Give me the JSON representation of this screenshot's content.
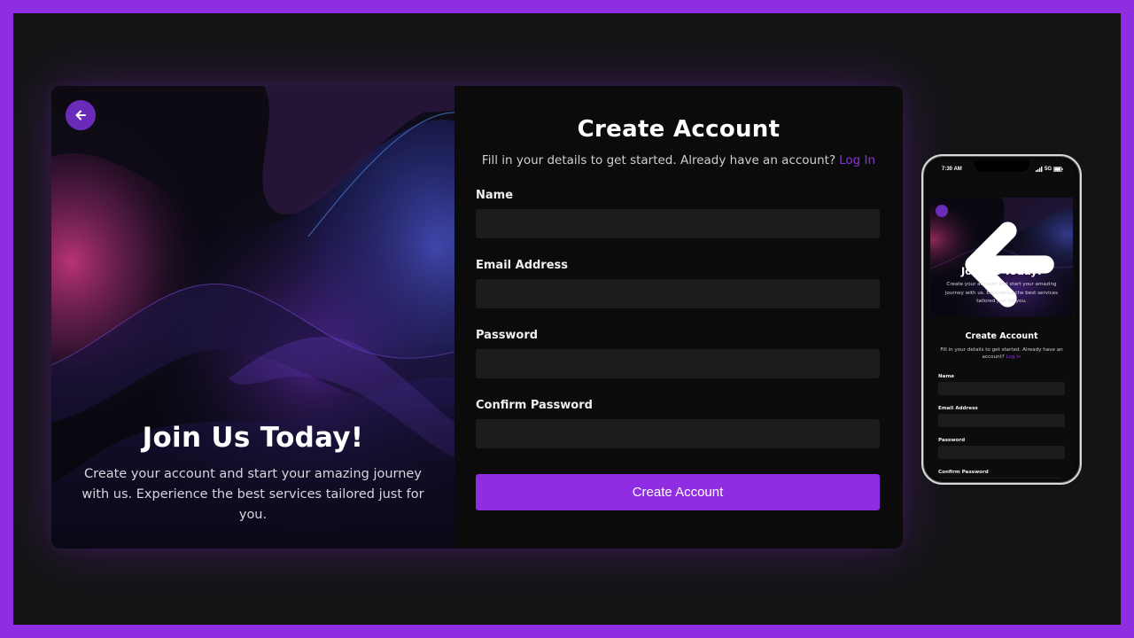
{
  "desktop": {
    "hero": {
      "back_icon": "arrow-left-icon",
      "title": "Join Us Today!",
      "description": "Create your account and start your amazing journey with us. Experience the best services tailored just for you."
    },
    "form": {
      "title": "Create Account",
      "subtitle": "Fill in your details to get started. Already have an account?",
      "login_link": "Log In",
      "fields": [
        {
          "label": "Name",
          "value": ""
        },
        {
          "label": "Email Address",
          "value": ""
        },
        {
          "label": "Password",
          "value": ""
        },
        {
          "label": "Confirm Password",
          "value": ""
        }
      ],
      "submit_label": "Create Account"
    }
  },
  "phone": {
    "status": {
      "time": "7:30 AM",
      "signal": "5G"
    },
    "hero": {
      "title": "Join Us Today!",
      "description": "Create your account and start your amazing journey with us. Experience the best services tailored just for you."
    },
    "form": {
      "title": "Create Account",
      "subtitle": "Fill in your details to get started. Already have an account?",
      "login_link": "Log In",
      "fields": [
        {
          "label": "Name"
        },
        {
          "label": "Email Address"
        },
        {
          "label": "Password"
        },
        {
          "label": "Confirm Password"
        }
      ]
    }
  },
  "colors": {
    "accent": "#8e2de2",
    "frame": "#8e2de2",
    "background": "#141415",
    "input_bg": "#1c1c1e"
  }
}
